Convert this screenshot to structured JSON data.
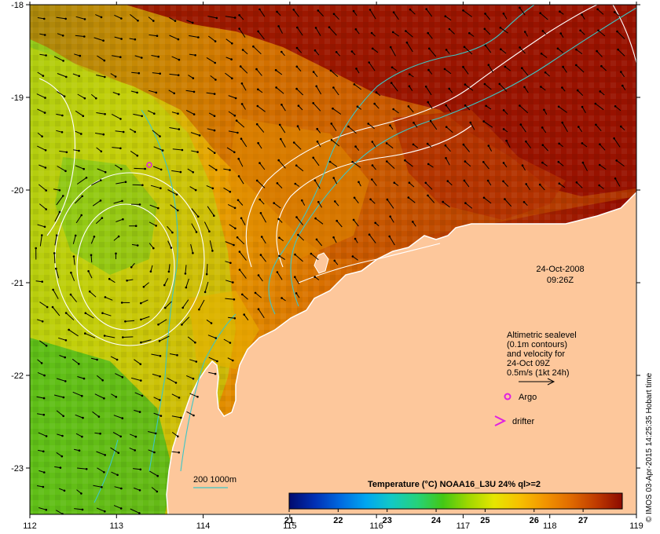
{
  "map": {
    "x_ticks": [
      "112",
      "113",
      "114",
      "115",
      "116",
      "117",
      "118",
      "119"
    ],
    "y_ticks": [
      "-18",
      "-19",
      "-20",
      "-21",
      "-22",
      "-23"
    ],
    "date_line1": "24-Oct-2008",
    "date_line2": "09:26Z"
  },
  "legend": {
    "sealevel_lines": [
      "Altimetric sealevel",
      "(0.1m contours)",
      "and velocity for",
      "24-Oct 09Z",
      "0.5m/s (1kt 24h)"
    ],
    "argo_label": "Argo",
    "drifter_label": "drifter",
    "bathy_label": "200  1000m"
  },
  "colorbar": {
    "title": "Temperature (°C) NOAA16_L3U 24% ql>=2",
    "ticks": [
      "21",
      "22",
      "23",
      "24",
      "25",
      "26",
      "27"
    ],
    "vmin": 21,
    "vmax": 27.8,
    "colors": [
      "#000a6e",
      "#0030b4",
      "#006ae0",
      "#00a6f0",
      "#12c9c4",
      "#25d27a",
      "#43c814",
      "#a0d800",
      "#e6e600",
      "#f7c000",
      "#f29400",
      "#e06a00",
      "#bf3a00",
      "#8c0a00"
    ]
  },
  "credit": "© IMOS 03-Apr-2015 14:25:35 Hobart time",
  "colors": {
    "land": "#fdc79b",
    "hot": "#960e00",
    "current_line": "#3cc6c6",
    "contour_line": "#ffffff",
    "argo": "#e020e0",
    "drifter": "#e020e0"
  }
}
